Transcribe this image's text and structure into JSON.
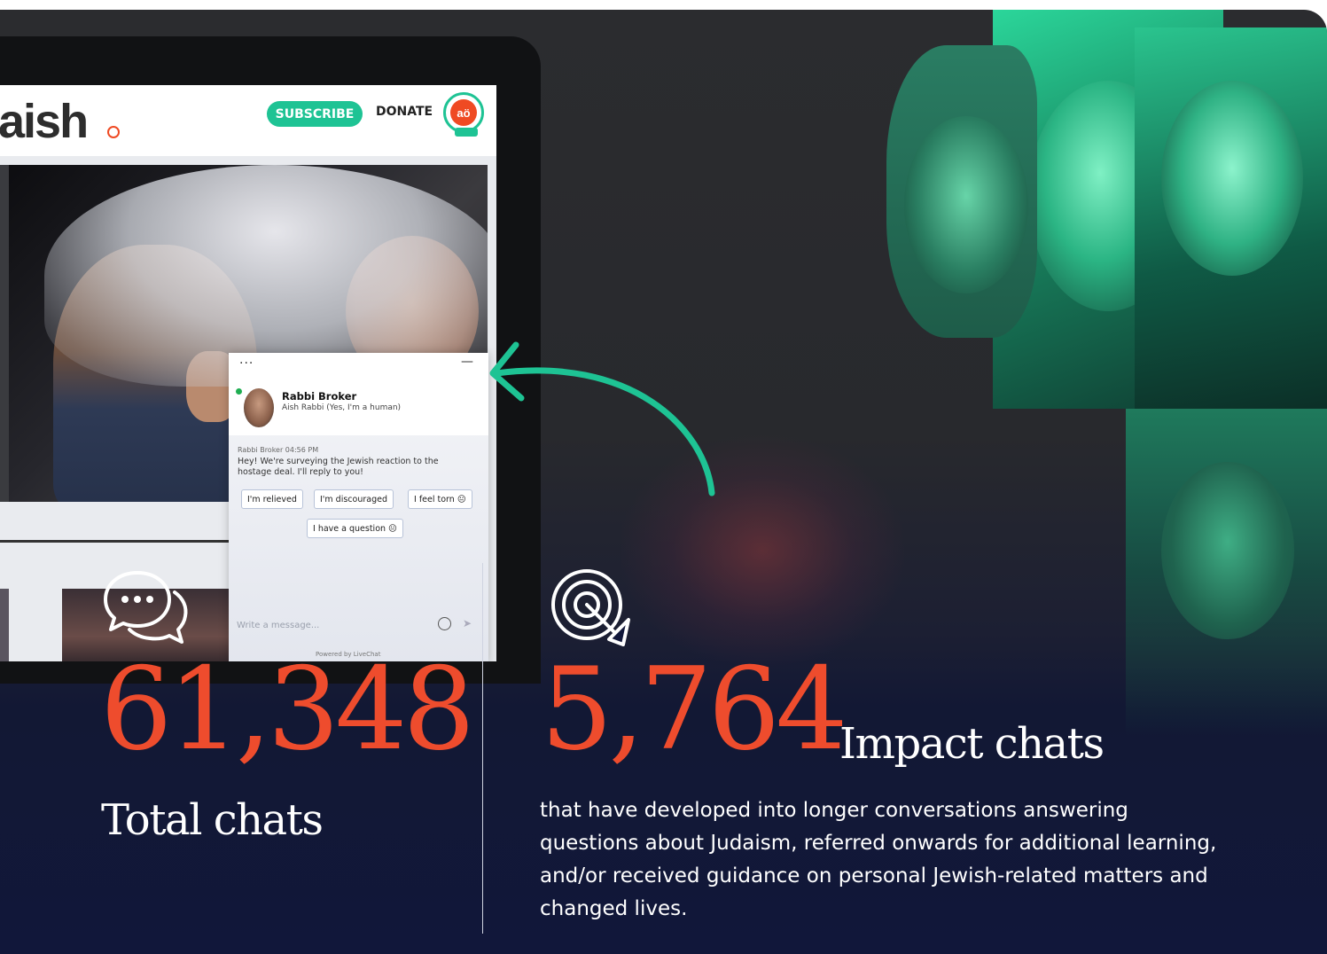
{
  "site": {
    "logo": "aish",
    "subscribe_label": "SUBSCRIBE",
    "donate_label": "DONATE",
    "badge_text": "aö"
  },
  "chat": {
    "dots": "···",
    "minimize": "—",
    "agent_name": "Rabbi Broker",
    "agent_role": "Aish Rabbi (Yes, I'm a human)",
    "meta": "Rabbi Broker 04:56 PM",
    "message": "Hey! We're surveying the Jewish reaction to the hostage deal. I'll reply to you!",
    "quick_replies": [
      "I'm relieved",
      "I'm discouraged",
      "I feel torn 😐",
      "I have a question 😐"
    ],
    "input_placeholder": "Write a message...",
    "footer": "Powered by LiveChat"
  },
  "stats": {
    "total": {
      "value": "61,348",
      "label": "Total chats",
      "icon": "chat-bubbles-icon"
    },
    "impact": {
      "value": "5,764",
      "label": "Impact chats",
      "icon": "target-icon",
      "description": "that have developed into longer conversations answering questions about Judaism, referred onwards for additional learning, and/or received guidance on personal Jewish-related matters and changed lives."
    }
  },
  "colors": {
    "accent_orange": "#ee4c2d",
    "accent_green": "#1ec394",
    "navy": "#11173a"
  }
}
